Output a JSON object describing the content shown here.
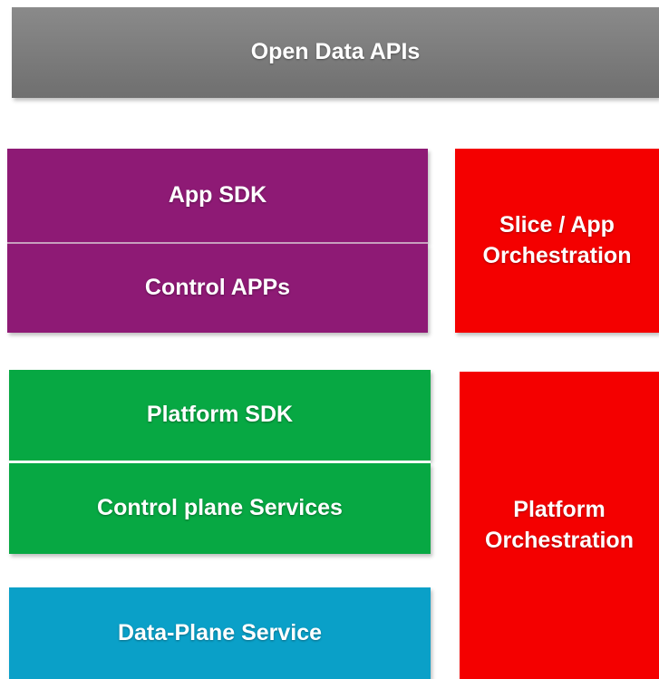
{
  "diagram": {
    "open_data_apis": "Open Data APIs",
    "app_sdk": "App SDK",
    "control_apps": "Control APPs",
    "slice_app_orchestration": [
      "Slice / App",
      "Orchestration"
    ],
    "platform_sdk": "Platform SDK",
    "control_plane_services": "Control plane Services",
    "data_plane_service": "Data-Plane Service",
    "platform_orchestration": [
      "Platform",
      "Orchestration"
    ]
  },
  "colors": {
    "gray_layer": "#7a7a7a",
    "purple_layer": "#8e1a75",
    "green_layer": "#07a843",
    "blue_layer": "#0aa0c8",
    "red_orchestration": "#f40000"
  }
}
